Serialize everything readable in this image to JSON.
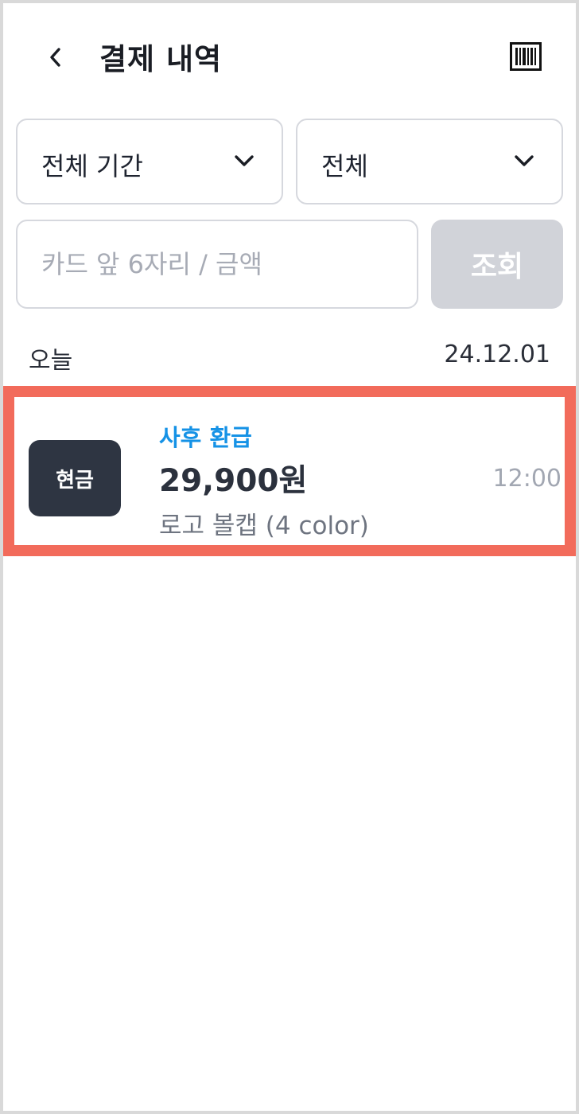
{
  "header": {
    "title": "결제 내역",
    "back_icon": "chevron-left-icon",
    "barcode_icon": "barcode-icon"
  },
  "filters": {
    "period": {
      "selected": "전체 기간",
      "icon": "chevron-down-icon"
    },
    "type": {
      "selected": "전체",
      "icon": "chevron-down-icon"
    }
  },
  "search": {
    "placeholder": "카드 앞 6자리 / 금액",
    "value": "",
    "button_label": "조회"
  },
  "groups": [
    {
      "day_label": "오늘",
      "date": "24.12.01",
      "transactions": [
        {
          "method": "현금",
          "status": "사후 환급",
          "amount": "29,900원",
          "product": "로고 볼캡 (4 color)",
          "time": "12:00"
        }
      ]
    }
  ],
  "colors": {
    "status_accent": "#1592e6",
    "highlight_border": "#f26b5b",
    "badge_bg": "#2e3542",
    "disabled_button": "#d1d3d9"
  }
}
